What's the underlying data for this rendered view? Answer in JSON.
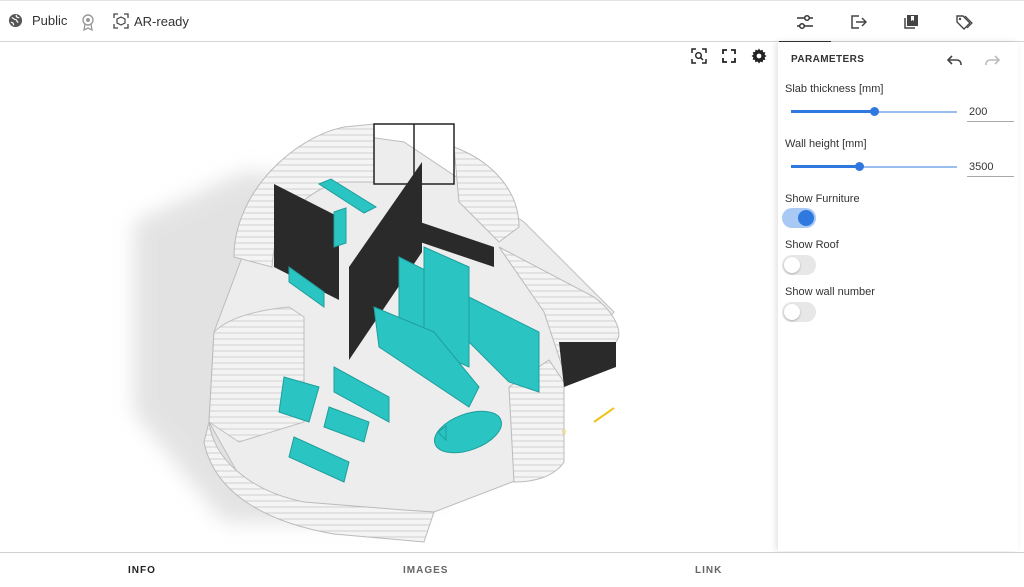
{
  "topbar": {
    "visibility_label": "Public",
    "ar_label": "AR-ready",
    "icons": [
      "globe-icon",
      "badge-icon",
      "ar-cube-icon"
    ],
    "tabs": [
      {
        "name": "parameters",
        "icon": "sliders-icon",
        "active": true
      },
      {
        "name": "export",
        "icon": "export-icon",
        "active": false
      },
      {
        "name": "library",
        "icon": "library-icon",
        "active": false
      },
      {
        "name": "tags",
        "icon": "tags-icon",
        "active": false
      }
    ]
  },
  "viewer": {
    "tools": [
      "zoom-fit-icon",
      "fullscreen-icon",
      "gear-icon"
    ]
  },
  "panel": {
    "title": "PARAMETERS",
    "slab": {
      "label": "Slab thickness [mm]",
      "value": "200",
      "fraction": 0.5
    },
    "wall": {
      "label": "Wall height [mm]",
      "value": "3500",
      "fraction": 0.41
    },
    "toggles": [
      {
        "label": "Show Furniture",
        "on": true
      },
      {
        "label": "Show Roof",
        "on": false
      },
      {
        "label": "Show wall number",
        "on": false
      }
    ]
  },
  "bottom_tabs": [
    {
      "label": "INFO",
      "active": true
    },
    {
      "label": "IMAGES",
      "active": false
    },
    {
      "label": "LINK",
      "active": false
    }
  ],
  "colors": {
    "accent": "#2f78e0",
    "furniture": "#2ac4c2",
    "wall_dark": "#2a2a2a"
  }
}
